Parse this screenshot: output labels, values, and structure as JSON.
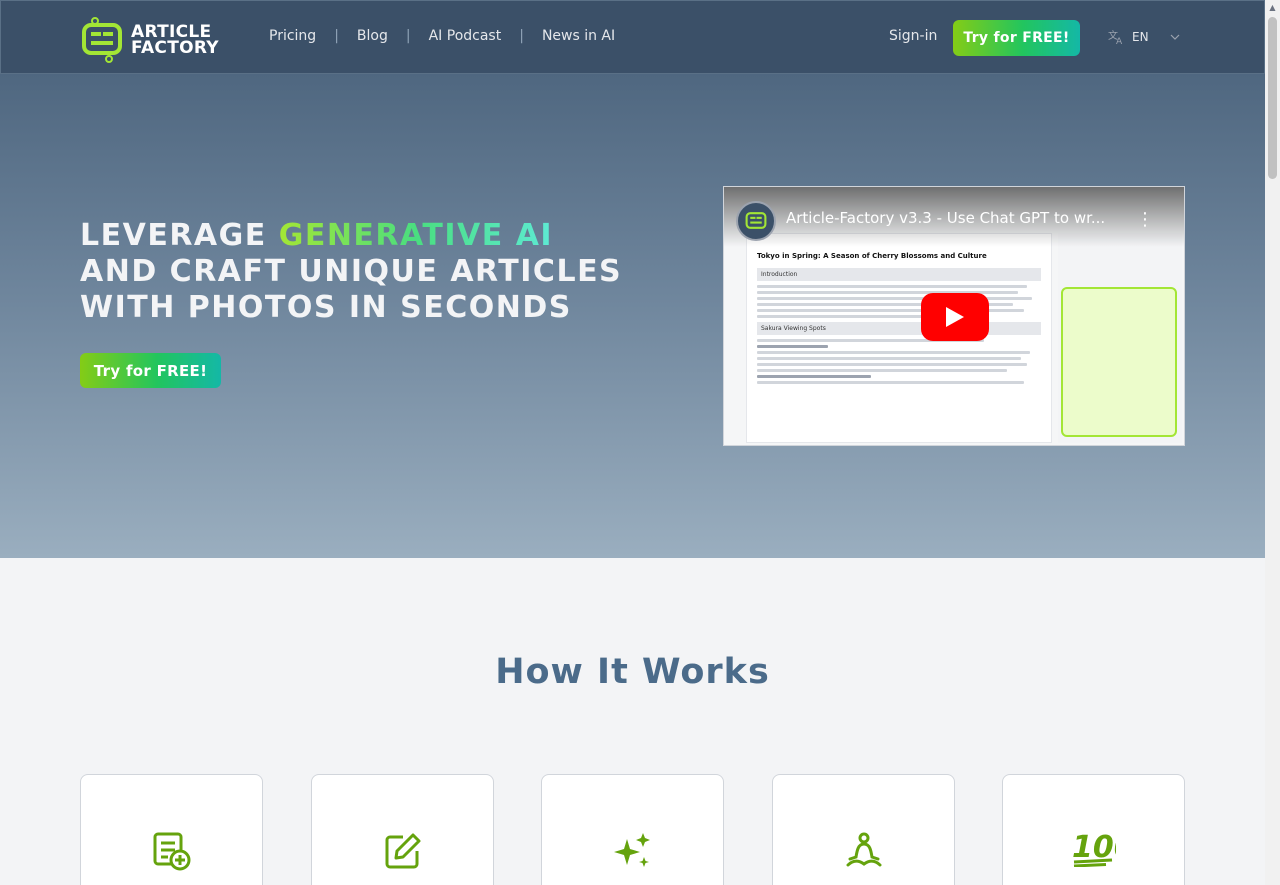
{
  "header": {
    "logo_line1": "ARTICLE",
    "logo_line2": "FACTORY",
    "nav": [
      "Pricing",
      "Blog",
      "AI Podcast",
      "News in AI"
    ],
    "signin": "Sign-in",
    "try_button": "Try for FREE!",
    "language": "EN"
  },
  "hero": {
    "title_part1": "LEVERAGE ",
    "title_highlight": "GENERATIVE AI",
    "title_part2": " AND CRAFT UNIQUE ARTICLES WITH PHOTOS IN SECONDS",
    "try_button": "Try for FREE!",
    "video": {
      "title": "Article-Factory v3.3 - Use Chat GPT to wr...",
      "doc_heading": "Tokyo in Spring: A Season of Cherry Blossoms and Culture",
      "doc_section1": "Introduction",
      "doc_section2": "Sakura Viewing Spots"
    }
  },
  "how": {
    "title": "How It Works",
    "cards": [
      {
        "icon": "document-plus-icon"
      },
      {
        "icon": "pencil-square-icon"
      },
      {
        "icon": "sparkles-icon"
      },
      {
        "icon": "meditation-icon"
      },
      {
        "icon": "hundred-icon"
      }
    ]
  },
  "colors": {
    "header_bg": "#3b5068",
    "accent_green": "#84cc16",
    "accent_teal": "#14b8a6",
    "how_title": "#4b6b8a"
  }
}
